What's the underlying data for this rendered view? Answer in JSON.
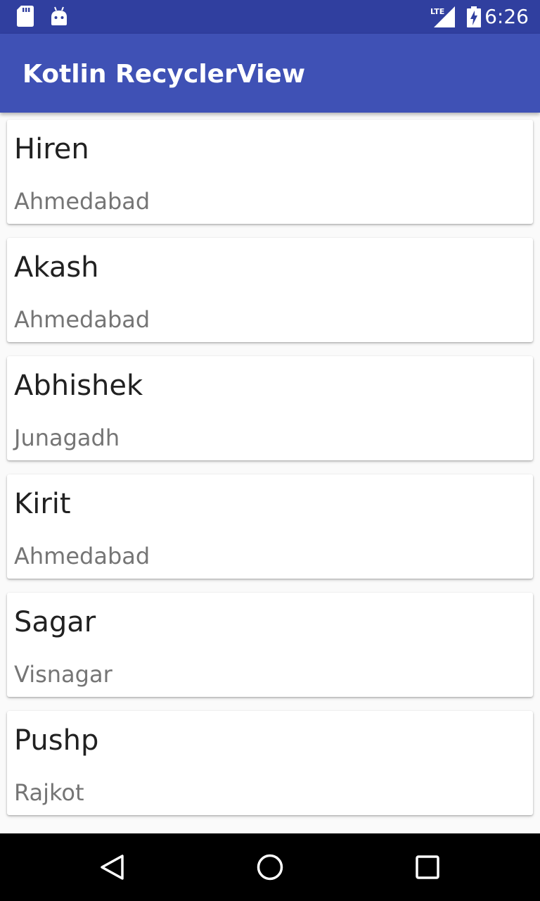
{
  "status_bar": {
    "time": "6:26",
    "network": "LTE",
    "icons": [
      "sd-card-icon",
      "android-debug-icon",
      "lte-signal-icon",
      "battery-charging-icon"
    ]
  },
  "app_bar": {
    "title": "Kotlin RecyclerView"
  },
  "list": {
    "items": [
      {
        "name": "Hiren",
        "city": "Ahmedabad"
      },
      {
        "name": "Akash",
        "city": "Ahmedabad"
      },
      {
        "name": "Abhishek",
        "city": "Junagadh"
      },
      {
        "name": "Kirit",
        "city": "Ahmedabad"
      },
      {
        "name": "Sagar",
        "city": "Visnagar"
      },
      {
        "name": "Pushp",
        "city": "Rajkot"
      }
    ]
  },
  "nav_bar": {
    "icons": [
      "back-icon",
      "home-icon",
      "recents-icon"
    ]
  },
  "colors": {
    "primary": "#3f51b5",
    "primary_dark": "#303f9f",
    "name_text": "#212121",
    "city_text": "#757575"
  }
}
